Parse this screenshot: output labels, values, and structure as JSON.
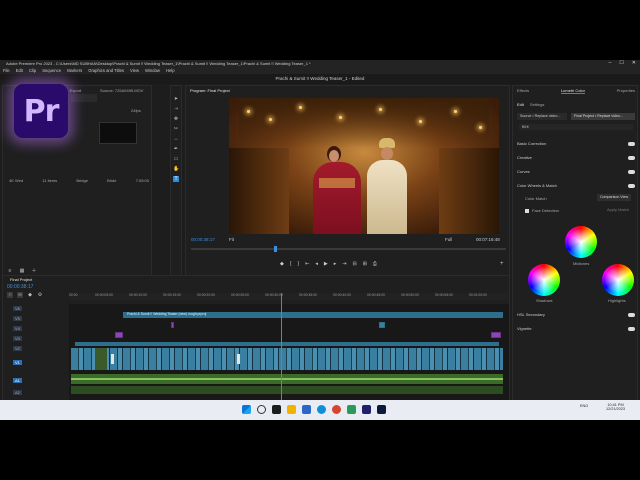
{
  "window": {
    "title": "Adobe Premiere Pro 2023 - C:\\Users\\MD SUBHAN\\Desktop\\Prachi & Sumit !! Wedding Teaser_1\\Prachi & Sumit !! Wedding Teaser_1\\Prachi & Sumit !! Wedding Teaser_1 *",
    "sequence_title": "Prachi & Sumit !! Wedding Teaser_1 - Edited"
  },
  "menu": [
    "File",
    "Edit",
    "Clip",
    "Sequence",
    "Markers",
    "Graphics and Titles",
    "View",
    "Window",
    "Help"
  ],
  "logo": {
    "text": "Pr"
  },
  "project_panel": {
    "tabs": [
      "Project",
      "Effects",
      "Export"
    ],
    "source_tab": "Source: 725A9495.MOV",
    "fps": "24fps",
    "items": [
      {
        "name": "4K Wed",
        "duration": ""
      },
      {
        "name": "11 items",
        "duration": ""
      },
      {
        "name": "Bridge",
        "duration": ""
      },
      {
        "name": "Bride",
        "duration": ""
      },
      {
        "name": "7:05:00",
        "duration": ""
      }
    ]
  },
  "program_monitor": {
    "tab": "Program: Final Project",
    "current_time": "00:00:38:17",
    "zoom": "Fit",
    "quality": "Full",
    "duration": "00:07:16:48"
  },
  "timeline": {
    "tab": "Final Project",
    "time": "00:00:38:17",
    "ruler": [
      "00:00",
      "00:00:05:00",
      "00:00:10:00",
      "00:00:15:00",
      "00:00:20:00",
      "00:00:25:00",
      "00:00:30:00",
      "00:00:35:00",
      "00:00:40:00",
      "00:00:45:00",
      "00:00:50:00",
      "00:00:55:00",
      "00:01:00:00"
    ],
    "title_clip": "Prachi & Sumit !! Wedding Teaser (new) rough.prproj",
    "tracks": [
      "V6",
      "V5",
      "V4",
      "V3",
      "V2",
      "V1",
      "A1",
      "A2"
    ]
  },
  "lumetri": {
    "tabs": [
      "Effects",
      "Lumetri Color",
      "Properties"
    ],
    "subtabs": [
      "Edit",
      "Settings"
    ],
    "source_label": "Source • Replace video...",
    "target_label": "Final Project • Replace video...",
    "effect_select": "fill it",
    "sections": [
      "Basic Correction",
      "Creative",
      "Curves",
      "Color Wheels & Match",
      "HSL Secondary",
      "Vignette"
    ],
    "color_match_label": "Color Match",
    "comparison_view": "Comparison View",
    "face_detection": "Face Detection",
    "apply_match": "Apply Match",
    "wheels": [
      "Midtones",
      "Shadows",
      "Highlights"
    ]
  },
  "taskbar": {
    "time": "10:41 PM",
    "date": "12/21/2023",
    "lang": "ENG"
  },
  "colors": {
    "accent": "#2b8cd8",
    "clip_blue": "#3b7fa0",
    "clip_purple": "#8c47b0",
    "audio_green": "#5c8a3c",
    "playhead": "#3e8ede"
  }
}
